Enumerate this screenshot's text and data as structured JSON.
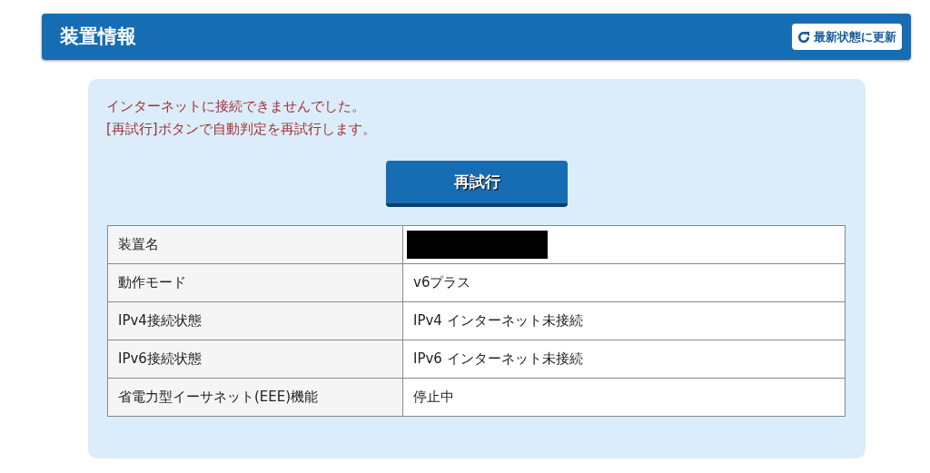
{
  "header": {
    "title": "装置情報",
    "refresh_button": "最新状態に更新"
  },
  "messages": [
    "インターネットに接続できませんでした。",
    "[再試行]ボタンで自動判定を再試行します。"
  ],
  "retry_button": "再試行",
  "table": {
    "rows": [
      {
        "label": "装置名",
        "redacted": true
      },
      {
        "label": "動作モード",
        "value": "v6プラス",
        "redacted": false
      },
      {
        "label": "IPv4接続状態",
        "value": "IPv4 インターネット未接続",
        "redacted": false
      },
      {
        "label": "IPv6接続状態",
        "value": "IPv6 インターネット未接続",
        "redacted": false
      },
      {
        "label": "省電力型イーサネット(EEE)機能",
        "value": "停止中",
        "redacted": false
      }
    ]
  }
}
